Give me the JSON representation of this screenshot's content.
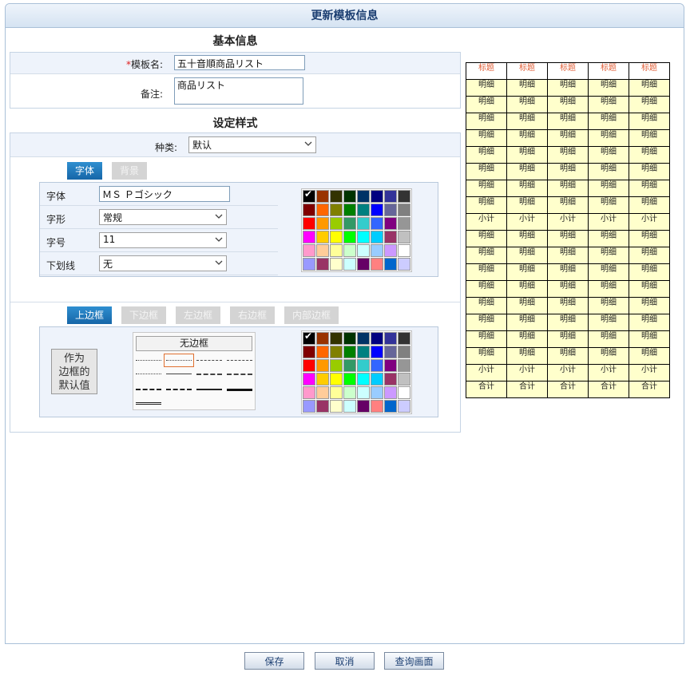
{
  "header": {
    "title": "更新模板信息"
  },
  "basic": {
    "title": "基本信息",
    "name_required_mark": "*",
    "name_label": "模板名:",
    "name_value": "五十音順商品リスト",
    "note_label": "备注:",
    "note_value": "商品リスト"
  },
  "style": {
    "title": "设定样式",
    "kind_label": "种类:",
    "kind_value": "默认",
    "font_tabs": [
      "字体",
      "背景"
    ],
    "font_rows": [
      {
        "label": "字体",
        "value": "ＭＳ Ｐゴシック",
        "kind": "text"
      },
      {
        "label": "字形",
        "value": "常规",
        "kind": "select"
      },
      {
        "label": "字号",
        "value": "11",
        "kind": "select"
      },
      {
        "label": "下划线",
        "value": "无",
        "kind": "select"
      }
    ],
    "border_tabs": [
      "上边框",
      "下边框",
      "左边框",
      "右边框",
      "内部边框"
    ],
    "default_button": "作为\n边框的\n默认值",
    "no_border_button": "无边框"
  },
  "palette_colors": [
    "#000000",
    "#993300",
    "#333300",
    "#003300",
    "#003366",
    "#000080",
    "#333399",
    "#333333",
    "#800000",
    "#FF6600",
    "#808000",
    "#008000",
    "#008080",
    "#0000FF",
    "#666699",
    "#808080",
    "#FF0000",
    "#FF9900",
    "#99CC00",
    "#339966",
    "#33CCCC",
    "#3366FF",
    "#800080",
    "#969696",
    "#FF00FF",
    "#FFCC00",
    "#FFFF00",
    "#00FF00",
    "#00FFFF",
    "#00CCFF",
    "#993366",
    "#C0C0C0",
    "#FF99CC",
    "#FFCC99",
    "#FFFF99",
    "#CCFFCC",
    "#CCFFFF",
    "#99CCFF",
    "#CC99FF",
    "#FFFFFF",
    "#9999FF",
    "#993366",
    "#FFFFCC",
    "#CCFFFF",
    "#660066",
    "#FF8080",
    "#0066CC",
    "#CCCCFF"
  ],
  "preview": {
    "rows": [
      [
        "标题",
        "标题",
        "标题",
        "标题",
        "标题"
      ],
      [
        "明细",
        "明细",
        "明细",
        "明细",
        "明细"
      ],
      [
        "明细",
        "明细",
        "明细",
        "明细",
        "明细"
      ],
      [
        "明细",
        "明细",
        "明细",
        "明细",
        "明细"
      ],
      [
        "明细",
        "明细",
        "明细",
        "明细",
        "明细"
      ],
      [
        "明细",
        "明细",
        "明细",
        "明细",
        "明细"
      ],
      [
        "明细",
        "明细",
        "明细",
        "明细",
        "明细"
      ],
      [
        "明细",
        "明细",
        "明细",
        "明细",
        "明细"
      ],
      [
        "明细",
        "明细",
        "明细",
        "明细",
        "明细"
      ],
      [
        "小计",
        "小计",
        "小计",
        "小计",
        "小计"
      ],
      [
        "明细",
        "明细",
        "明细",
        "明细",
        "明细"
      ],
      [
        "明细",
        "明细",
        "明细",
        "明细",
        "明细"
      ],
      [
        "明细",
        "明细",
        "明细",
        "明细",
        "明细"
      ],
      [
        "明细",
        "明细",
        "明细",
        "明细",
        "明细"
      ],
      [
        "明细",
        "明细",
        "明细",
        "明细",
        "明细"
      ],
      [
        "明细",
        "明细",
        "明细",
        "明细",
        "明细"
      ],
      [
        "明细",
        "明细",
        "明细",
        "明细",
        "明细"
      ],
      [
        "明细",
        "明细",
        "明细",
        "明细",
        "明细"
      ],
      [
        "小计",
        "小计",
        "小计",
        "小计",
        "小计"
      ],
      [
        "合计",
        "合计",
        "合计",
        "合计",
        "合计"
      ]
    ]
  },
  "buttons": {
    "save": "保存",
    "cancel": "取消",
    "query": "查询画面"
  }
}
